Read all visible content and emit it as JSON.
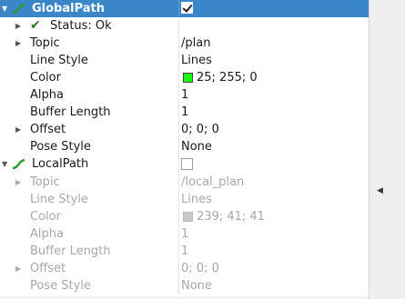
{
  "colors": {
    "selection": "#3a86c8",
    "global_swatch": "#19ff00",
    "local_swatch": "#c8c8c8",
    "path_icon": "#2e9b2e"
  },
  "rows": {
    "global": {
      "name": "GlobalPath",
      "checked": true
    },
    "status": {
      "label": "Status: Ok"
    },
    "topic": {
      "label": "Topic",
      "value": "/plan"
    },
    "line_style": {
      "label": "Line Style",
      "value": "Lines"
    },
    "color": {
      "label": "Color",
      "value": "25; 255; 0"
    },
    "alpha": {
      "label": "Alpha",
      "value": "1"
    },
    "buffer": {
      "label": "Buffer Length",
      "value": "1"
    },
    "offset": {
      "label": "Offset",
      "value": "0; 0; 0"
    },
    "pose_style": {
      "label": "Pose Style",
      "value": "None"
    },
    "local": {
      "name": "LocalPath",
      "checked": false
    },
    "l_topic": {
      "label": "Topic",
      "value": "/local_plan"
    },
    "l_line_style": {
      "label": "Line Style",
      "value": "Lines"
    },
    "l_color": {
      "label": "Color",
      "value": "239; 41; 41"
    },
    "l_alpha": {
      "label": "Alpha",
      "value": "1"
    },
    "l_buffer": {
      "label": "Buffer Length",
      "value": "1"
    },
    "l_offset": {
      "label": "Offset",
      "value": "0; 0; 0"
    },
    "l_pose_style": {
      "label": "Pose Style",
      "value": "None"
    }
  }
}
